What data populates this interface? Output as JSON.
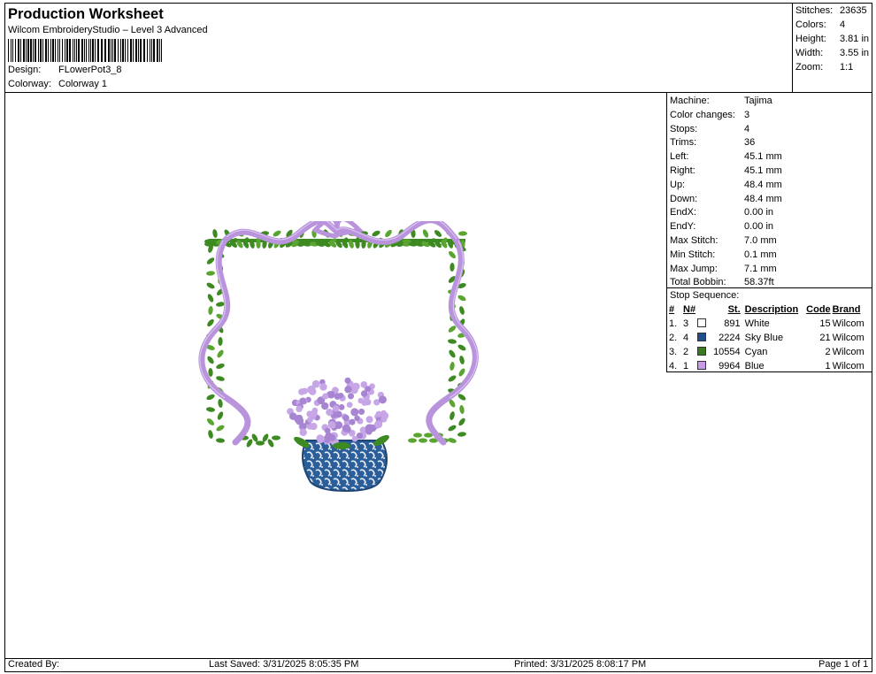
{
  "header": {
    "title": "Production Worksheet",
    "software": "Wilcom EmbroideryStudio – Level 3 Advanced",
    "design_label": "Design:",
    "design_value": "FLowerPot3_8",
    "colorway_label": "Colorway:",
    "colorway_value": "Colorway 1"
  },
  "stats": [
    {
      "label": "Stitches:",
      "value": "23635"
    },
    {
      "label": "Colors:",
      "value": "4"
    },
    {
      "label": "Height:",
      "value": "3.81 in"
    },
    {
      "label": "Width:",
      "value": "3.55 in"
    },
    {
      "label": "Zoom:",
      "value": "1:1"
    }
  ],
  "machine_info": [
    {
      "label": "Machine:",
      "value": "Tajima"
    },
    {
      "label": "Color changes:",
      "value": "3"
    },
    {
      "label": "Stops:",
      "value": "4"
    },
    {
      "label": "Trims:",
      "value": "36"
    },
    {
      "label": "Left:",
      "value": "45.1 mm"
    },
    {
      "label": "Right:",
      "value": "45.1 mm"
    },
    {
      "label": "Up:",
      "value": "48.4 mm"
    },
    {
      "label": "Down:",
      "value": "48.4 mm"
    },
    {
      "label": "EndX:",
      "value": "0.00 in"
    },
    {
      "label": "EndY:",
      "value": "0.00 in"
    },
    {
      "label": "Max Stitch:",
      "value": "7.0 mm"
    },
    {
      "label": "Min Stitch:",
      "value": "0.1 mm"
    },
    {
      "label": "Max Jump:",
      "value": "7.1 mm"
    },
    {
      "label": "Total Bobbin:",
      "value": "58.37ft"
    }
  ],
  "stop_sequence": {
    "title": "Stop Sequence:",
    "headers": {
      "idx": "#",
      "n": "N#",
      "st": "St.",
      "desc": "Description",
      "code": "Code",
      "brand": "Brand"
    },
    "rows": [
      {
        "idx": "1.",
        "n": "3",
        "color": "#ffffff",
        "st": "891",
        "desc": "White",
        "code": "15",
        "brand": "Wilcom"
      },
      {
        "idx": "2.",
        "n": "4",
        "color": "#1f4f8c",
        "st": "2224",
        "desc": "Sky Blue",
        "code": "21",
        "brand": "Wilcom"
      },
      {
        "idx": "3.",
        "n": "2",
        "color": "#3a7a1e",
        "st": "10554",
        "desc": "Cyan",
        "code": "2",
        "brand": "Wilcom"
      },
      {
        "idx": "4.",
        "n": "1",
        "color": "#c79be6",
        "st": "9964",
        "desc": "Blue",
        "code": "1",
        "brand": "Wilcom"
      }
    ]
  },
  "footer": {
    "created_by": "Created By:",
    "last_saved": "Last Saved: 3/31/2025 8:05:35 PM",
    "printed": "Printed: 3/31/2025 8:08:17 PM",
    "page": "Page 1 of 1"
  },
  "colors": {
    "leaf_green": "#3e8a22",
    "ribbon_lilac": "#b993dc",
    "vase_blue": "#2c5f9a",
    "hydrangea": "#c6a6e6"
  }
}
